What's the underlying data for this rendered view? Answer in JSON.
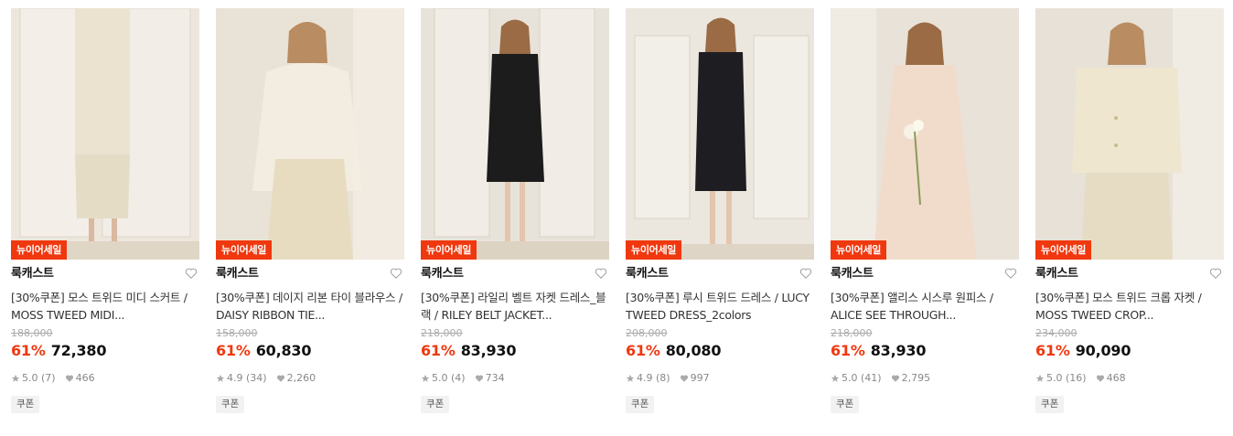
{
  "products": [
    {
      "badge": "뉴이어세일",
      "brand": "룩캐스트",
      "name": "[30%쿠폰] 모스 트위드 미디 스커트 / MOSS TWEED MIDI...",
      "original_price": "188,000",
      "discount": "61%",
      "price": "72,380",
      "rating": "5.0",
      "reviews": "(7)",
      "likes": "466",
      "coupon": "쿠폰",
      "palette": {
        "bg": "#ece6dc",
        "garment": "#ebe3cf"
      }
    },
    {
      "badge": "뉴이어세일",
      "brand": "룩캐스트",
      "name": "[30%쿠폰] 데이지 리본 타이 블라우스 / DAISY RIBBON TIE...",
      "original_price": "158,000",
      "discount": "61%",
      "price": "60,830",
      "rating": "4.9",
      "reviews": "(34)",
      "likes": "2,260",
      "coupon": "쿠폰",
      "palette": {
        "bg": "#e9e2d6",
        "garment": "#f3ede1"
      }
    },
    {
      "badge": "뉴이어세일",
      "brand": "룩캐스트",
      "name": "[30%쿠폰] 라일리 벨트 자켓 드레스_블랙 / RILEY BELT JACKET...",
      "original_price": "218,000",
      "discount": "61%",
      "price": "83,930",
      "rating": "5.0",
      "reviews": "(4)",
      "likes": "734",
      "coupon": "쿠폰",
      "palette": {
        "bg": "#e8e3da",
        "garment": "#1c1c1c"
      }
    },
    {
      "badge": "뉴이어세일",
      "brand": "룩캐스트",
      "name": "[30%쿠폰] 루시 트위드 드레스 / LUCY TWEED DRESS_2colors",
      "original_price": "208,000",
      "discount": "61%",
      "price": "80,080",
      "rating": "4.9",
      "reviews": "(8)",
      "likes": "997",
      "coupon": "쿠폰",
      "palette": {
        "bg": "#ebe6de",
        "garment": "#1e1e22"
      }
    },
    {
      "badge": "뉴이어세일",
      "brand": "룩캐스트",
      "name": "[30%쿠폰] 앨리스 시스루 원피스 / ALICE SEE THROUGH...",
      "original_price": "218,000",
      "discount": "61%",
      "price": "83,930",
      "rating": "5.0",
      "reviews": "(41)",
      "likes": "2,795",
      "coupon": "쿠폰",
      "palette": {
        "bg": "#e9e2d8",
        "garment": "#f1dccb"
      }
    },
    {
      "badge": "뉴이어세일",
      "brand": "룩캐스트",
      "name": "[30%쿠폰] 모스 트위드 크롭 자켓 / MOSS TWEED CROP...",
      "original_price": "234,000",
      "discount": "61%",
      "price": "90,090",
      "rating": "5.0",
      "reviews": "(16)",
      "likes": "468",
      "coupon": "쿠폰",
      "palette": {
        "bg": "#e7e1d7",
        "garment": "#efe6d0"
      }
    }
  ],
  "colors": {
    "accent": "#f0380f",
    "muted": "#888888"
  }
}
